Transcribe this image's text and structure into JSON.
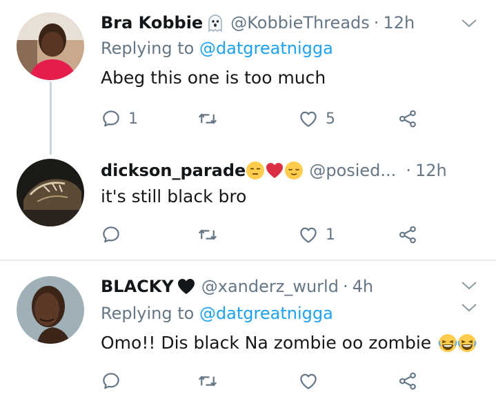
{
  "tweets": [
    {
      "name": "Bra Kobbie",
      "name_emoji": "ghost-emoji",
      "handle": "@KobbieThreads",
      "dot": "·",
      "time": "12h",
      "replying_prefix": "Replying to ",
      "replying_to": "@datgreatnigga",
      "text": "Abeg this one is too much",
      "reply_count": "1",
      "retweet_count": "",
      "like_count": "5"
    },
    {
      "name": "dickson_parade",
      "name_emojis": [
        "expressionless-face-emoji",
        "red-heart-emoji",
        "relieved-face-emoji"
      ],
      "handle": "@posied...",
      "dot": "·",
      "time": "12h",
      "text": "it's still black bro",
      "reply_count": "",
      "retweet_count": "",
      "like_count": "1"
    },
    {
      "name": "BLACKY",
      "name_emoji": "black-heart-emoji",
      "handle": "@xanderz_wurld",
      "dot": "·",
      "time": "4h",
      "replying_prefix": "Replying to ",
      "replying_to": "@datgreatnigga",
      "text": "Omo!! Dis black Na zombie oo zombie",
      "text_emojis": [
        "laughing-face-emoji",
        "laughing-face-emoji"
      ],
      "reply_count": "",
      "retweet_count": "",
      "like_count": ""
    }
  ],
  "colors": {
    "text": "#14171a",
    "secondary": "#657786",
    "link": "#1da1f2",
    "divider": "#e6ecf0",
    "thread_line": "#ccd6dd"
  }
}
